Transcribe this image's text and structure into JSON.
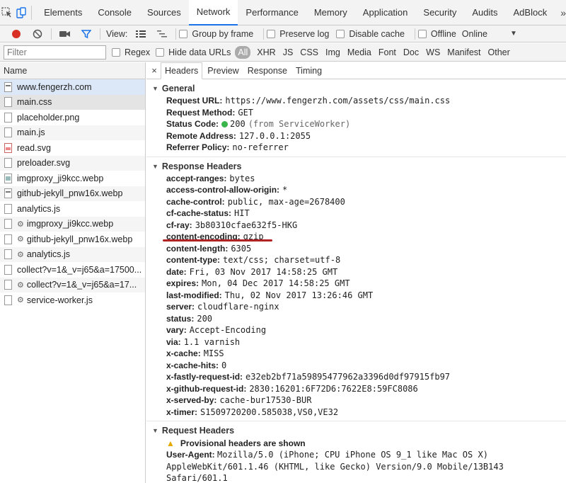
{
  "topbar": {
    "tabs": [
      "Elements",
      "Console",
      "Sources",
      "Network",
      "Performance",
      "Memory",
      "Application",
      "Security",
      "Audits",
      "AdBlock"
    ],
    "active": "Network",
    "more": "»"
  },
  "toolbar": {
    "view_label": "View:",
    "group_by_frame": "Group by frame",
    "preserve_log": "Preserve log",
    "disable_cache": "Disable cache",
    "offline": "Offline",
    "online": "Online",
    "caret": "▼",
    "record_color": "#d93025"
  },
  "filterbar": {
    "placeholder": "Filter",
    "regex": "Regex",
    "hide_data_urls": "Hide data URLs",
    "types": [
      "All",
      "XHR",
      "JS",
      "CSS",
      "Img",
      "Media",
      "Font",
      "Doc",
      "WS",
      "Manifest",
      "Other"
    ]
  },
  "requests": {
    "header": "Name",
    "items": [
      {
        "name": "www.fengerzh.com",
        "icon": "doc"
      },
      {
        "name": "main.css",
        "icon": "file"
      },
      {
        "name": "placeholder.png",
        "icon": "file"
      },
      {
        "name": "main.js",
        "icon": "file"
      },
      {
        "name": "read.svg",
        "icon": "svg"
      },
      {
        "name": "preloader.svg",
        "icon": "file"
      },
      {
        "name": "imgproxy_ji9kcc.webp",
        "icon": "img"
      },
      {
        "name": "github-jekyll_pnw16x.webp",
        "icon": "doc"
      },
      {
        "name": "analytics.js",
        "icon": "file"
      },
      {
        "name": "imgproxy_ji9kcc.webp",
        "icon": "gear"
      },
      {
        "name": "github-jekyll_pnw16x.webp",
        "icon": "gear"
      },
      {
        "name": "analytics.js",
        "icon": "gear"
      },
      {
        "name": "collect?v=1&_v=j65&a=17500...",
        "icon": "file"
      },
      {
        "name": "collect?v=1&_v=j65&a=17...",
        "icon": "gear"
      },
      {
        "name": "service-worker.js",
        "icon": "gear"
      }
    ]
  },
  "detail": {
    "close": "×",
    "tabs": [
      "Headers",
      "Preview",
      "Response",
      "Timing"
    ],
    "active": "Headers",
    "general": {
      "title": "General",
      "request_url_k": "Request URL:",
      "request_url_v": "https://www.fengerzh.com/assets/css/main.css",
      "method_k": "Request Method:",
      "method_v": "GET",
      "status_k": "Status Code:",
      "status_v": "200",
      "status_note": "(from ServiceWorker)",
      "remote_k": "Remote Address:",
      "remote_v": "127.0.0.1:2055",
      "referrer_k": "Referrer Policy:",
      "referrer_v": "no-referrer"
    },
    "response": {
      "title": "Response Headers",
      "headers": [
        {
          "k": "accept-ranges:",
          "v": "bytes"
        },
        {
          "k": "access-control-allow-origin:",
          "v": "*"
        },
        {
          "k": "cache-control:",
          "v": "public, max-age=2678400"
        },
        {
          "k": "cf-cache-status:",
          "v": "HIT"
        },
        {
          "k": "cf-ray:",
          "v": "3b80310cfae632f5-HKG"
        },
        {
          "k": "content-encoding:",
          "v": "gzip"
        },
        {
          "k": "content-length:",
          "v": "6305"
        },
        {
          "k": "content-type:",
          "v": "text/css; charset=utf-8"
        },
        {
          "k": "date:",
          "v": "Fri, 03 Nov 2017 14:58:25 GMT"
        },
        {
          "k": "expires:",
          "v": "Mon, 04 Dec 2017 14:58:25 GMT"
        },
        {
          "k": "last-modified:",
          "v": "Thu, 02 Nov 2017 13:26:46 GMT"
        },
        {
          "k": "server:",
          "v": "cloudflare-nginx"
        },
        {
          "k": "status:",
          "v": "200"
        },
        {
          "k": "vary:",
          "v": "Accept-Encoding"
        },
        {
          "k": "via:",
          "v": "1.1 varnish"
        },
        {
          "k": "x-cache:",
          "v": "MISS"
        },
        {
          "k": "x-cache-hits:",
          "v": "0"
        },
        {
          "k": "x-fastly-request-id:",
          "v": "e32eb2bf71a59895477962a3396d0df97915fb97"
        },
        {
          "k": "x-github-request-id:",
          "v": "2830:16201:6F72D6:7622E8:59FC8086"
        },
        {
          "k": "x-served-by:",
          "v": "cache-bur17530-BUR"
        },
        {
          "k": "x-timer:",
          "v": "S1509720200.585038,VS0,VE32"
        }
      ]
    },
    "request": {
      "title": "Request Headers",
      "warning": "Provisional headers are shown",
      "ua_k": "User-Agent:",
      "ua_v": "Mozilla/5.0 (iPhone; CPU iPhone OS 9_1 like Mac OS X) AppleWebKit/601.1.46 (KHTML, like Gecko) Version/9.0 Mobile/13B143 Safari/601.1"
    }
  },
  "annotation_color": "#b22222"
}
